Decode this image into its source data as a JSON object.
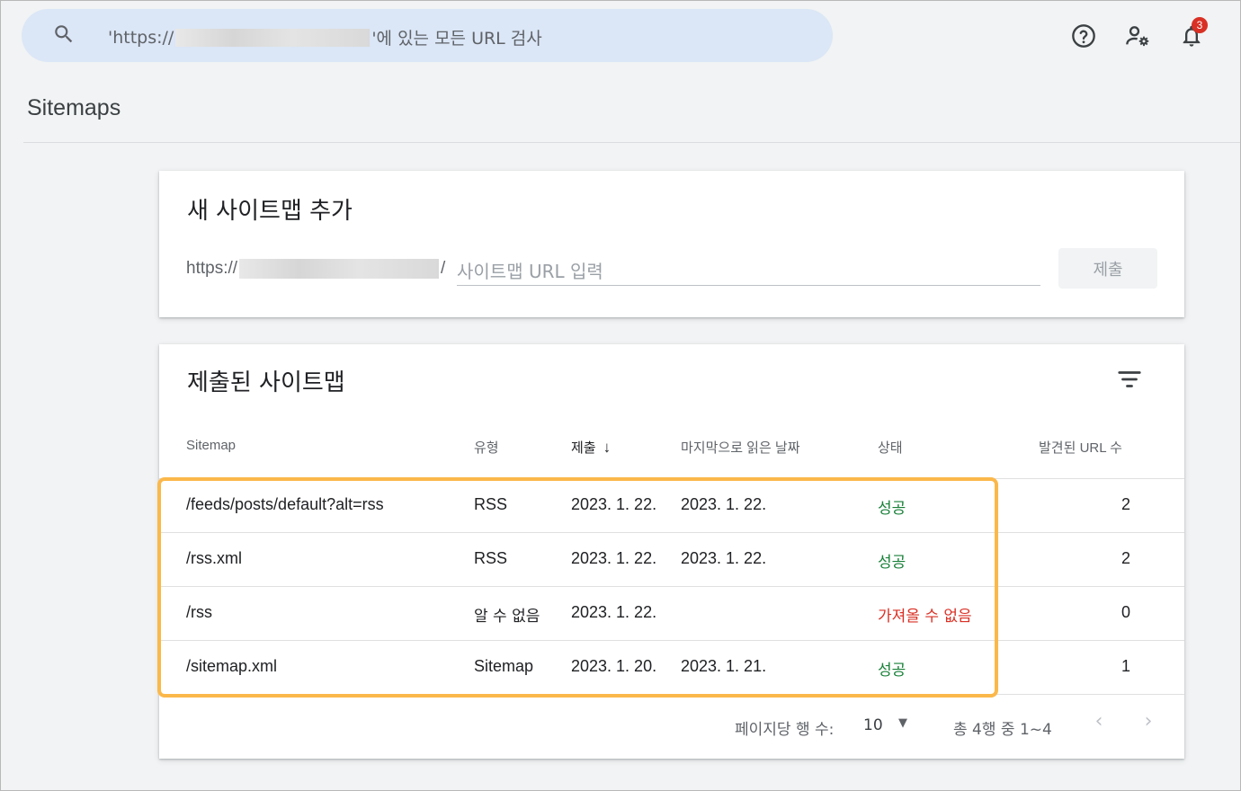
{
  "search": {
    "prefix": "'https://",
    "suffix": "'에 있는 모든 URL 검사"
  },
  "header": {
    "notification_count": "3"
  },
  "page_title": "Sitemaps",
  "add_card": {
    "title": "새 사이트맵 추가",
    "url_prefix": "https://",
    "url_slash": "/",
    "placeholder": "사이트맵 URL 입력",
    "submit_label": "제출"
  },
  "submitted_card": {
    "title": "제출된 사이트맵",
    "columns": {
      "sitemap": "Sitemap",
      "type": "유형",
      "submitted": "제출",
      "last_read": "마지막으로 읽은 날짜",
      "status": "상태",
      "found_urls": "발견된 URL 수"
    },
    "rows": [
      {
        "sitemap": "/feeds/posts/default?alt=rss",
        "type": "RSS",
        "submitted": "2023. 1. 22.",
        "last_read": "2023. 1. 22.",
        "status": "성공",
        "status_kind": "success",
        "found_urls": "2"
      },
      {
        "sitemap": "/rss.xml",
        "type": "RSS",
        "submitted": "2023. 1. 22.",
        "last_read": "2023. 1. 22.",
        "status": "성공",
        "status_kind": "success",
        "found_urls": "2"
      },
      {
        "sitemap": "/rss",
        "type": "알 수 없음",
        "submitted": "2023. 1. 22.",
        "last_read": "",
        "status": "가져올 수 없음",
        "status_kind": "error",
        "found_urls": "0"
      },
      {
        "sitemap": "/sitemap.xml",
        "type": "Sitemap",
        "submitted": "2023. 1. 20.",
        "last_read": "2023. 1. 21.",
        "status": "성공",
        "status_kind": "success",
        "found_urls": "1"
      }
    ],
    "pagination": {
      "rows_per_page_label": "페이지당 행 수:",
      "rows_per_page_value": "10",
      "range_label": "총 4행 중 1~4"
    }
  },
  "colors": {
    "success": "#188038",
    "error": "#d93025",
    "highlight": "#fbb84a",
    "search_bg": "#dbe6f6"
  },
  "icons": [
    "search-icon",
    "help-icon",
    "manage-users-icon",
    "notifications-icon",
    "filter-icon",
    "sort-arrow-down-icon",
    "dropdown-icon",
    "prev-page-icon",
    "next-page-icon"
  ]
}
